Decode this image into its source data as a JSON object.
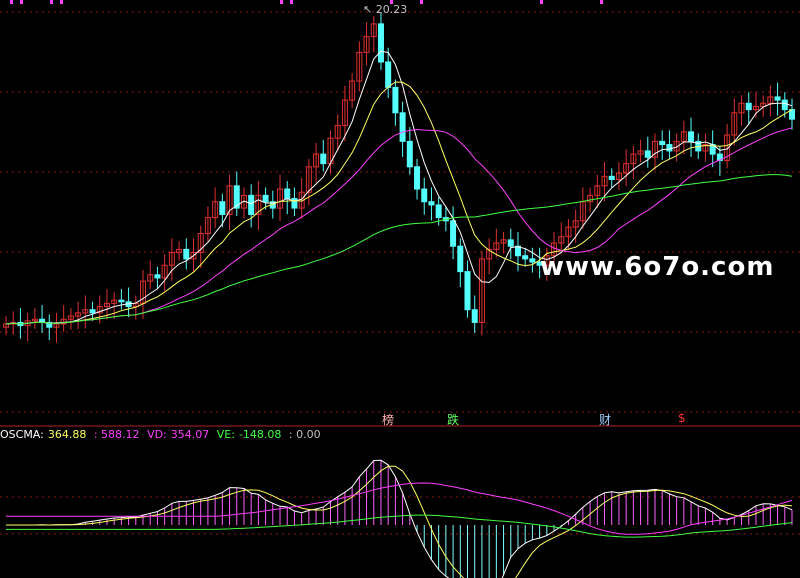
{
  "colors": {
    "background": "#000000",
    "up": "#e03030",
    "down": "#54ffff",
    "ma_white": "#ffffff",
    "ma_yellow": "#ffff60",
    "ma_magenta": "#ff40ff",
    "ma_green": "#40ff40",
    "grid": "#8b1a1a",
    "osc": "#ffffff",
    "vd": "#ff40ff",
    "ve": "#40ff40"
  },
  "price_panel": {
    "peak_label": "20.23",
    "watermark": "www.6o7o.com",
    "markers": [
      {
        "label": "榜",
        "color": "#ffb0b0",
        "bar": 53
      },
      {
        "label": "跌",
        "color": "#60ff60",
        "bar": 62
      },
      {
        "label": "财",
        "color": "#9fd0ff",
        "bar": 83
      },
      {
        "label": "$",
        "color": "#ff3030",
        "bar": 94
      }
    ]
  },
  "indicator_panel": {
    "name_label": "OSCMA:",
    "name_value": "364.88",
    "first_value": ": 588.12",
    "vd_label": "VD:",
    "vd_value": "354.07",
    "ve_label": "VE:",
    "ve_value": "-148.08",
    "last_value": ": 0.00"
  },
  "chart_data": {
    "type": "candlestick",
    "panels": [
      "price",
      "indicator"
    ],
    "ylim": [
      8.0,
      20.5
    ],
    "peak_value": 20.23,
    "closes": [
      10.55,
      10.6,
      10.5,
      10.65,
      10.7,
      10.6,
      10.45,
      10.55,
      10.7,
      10.8,
      10.9,
      11.0,
      10.9,
      11.1,
      11.2,
      11.3,
      11.25,
      11.1,
      11.2,
      11.9,
      12.1,
      12.0,
      12.4,
      12.8,
      12.9,
      12.6,
      12.8,
      13.4,
      13.9,
      14.4,
      14.0,
      14.9,
      14.2,
      14.6,
      14.0,
      14.6,
      14.4,
      14.2,
      14.8,
      14.5,
      14.2,
      14.7,
      15.5,
      15.9,
      15.6,
      16.4,
      16.8,
      17.6,
      18.2,
      19.1,
      19.6,
      20.0,
      18.8,
      18.0,
      17.2,
      16.3,
      15.5,
      14.8,
      14.4,
      14.3,
      13.9,
      13.8,
      13.0,
      12.2,
      11.0,
      10.6,
      12.6,
      12.9,
      13.1,
      13.2,
      13.0,
      12.7,
      12.6,
      12.5,
      12.4,
      12.7,
      13.1,
      13.3,
      13.6,
      13.8,
      14.4,
      14.6,
      14.9,
      15.2,
      15.1,
      15.3,
      15.6,
      15.9,
      16.0,
      15.8,
      16.3,
      16.2,
      16.0,
      16.3,
      16.6,
      16.3,
      16.0,
      16.2,
      15.9,
      15.7,
      16.5,
      17.2,
      17.5,
      17.3,
      17.4,
      17.5,
      17.7,
      17.6,
      17.3,
      17.0
    ],
    "series": [
      {
        "name": "OSCMA",
        "value": 364.88
      },
      {
        "name": "VD",
        "value": 354.07
      },
      {
        "name": "VE",
        "value": -148.08
      }
    ]
  }
}
